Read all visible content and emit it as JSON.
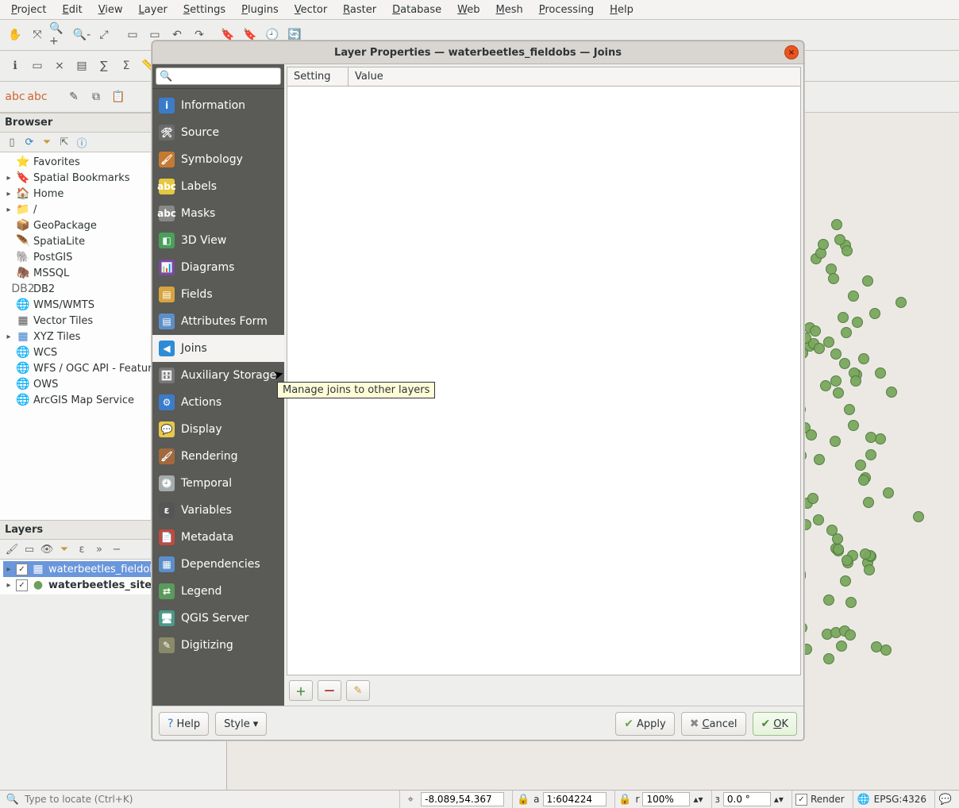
{
  "menubar": [
    "Project",
    "Edit",
    "View",
    "Layer",
    "Settings",
    "Plugins",
    "Vector",
    "Raster",
    "Database",
    "Web",
    "Mesh",
    "Processing",
    "Help"
  ],
  "browser": {
    "title": "Browser",
    "items": [
      {
        "exp": "",
        "icon": "⭐",
        "iconClass": "star",
        "label": "Favorites",
        "name": "favorites"
      },
      {
        "exp": "▸",
        "icon": "🔖",
        "iconClass": "",
        "label": "Spatial Bookmarks",
        "name": "spatial-bookmarks"
      },
      {
        "exp": "▸",
        "icon": "🏠",
        "iconClass": "",
        "label": "Home",
        "name": "home"
      },
      {
        "exp": "▸",
        "icon": "📁",
        "iconClass": "folder",
        "label": "/",
        "name": "root-folder"
      },
      {
        "exp": "",
        "icon": "📦",
        "iconClass": "pkg",
        "label": "GeoPackage",
        "name": "geopackage"
      },
      {
        "exp": "",
        "icon": "🪶",
        "iconClass": "",
        "label": "SpatiaLite",
        "name": "spatialite"
      },
      {
        "exp": "",
        "icon": "🐘",
        "iconClass": "",
        "label": "PostGIS",
        "name": "postgis"
      },
      {
        "exp": "",
        "icon": "🦣",
        "iconClass": "",
        "label": "MSSQL",
        "name": "mssql"
      },
      {
        "exp": "",
        "icon": "DB2",
        "iconClass": "db",
        "label": "DB2",
        "name": "db2"
      },
      {
        "exp": "",
        "icon": "🌐",
        "iconClass": "globe",
        "label": "WMS/WMTS",
        "name": "wms"
      },
      {
        "exp": "",
        "icon": "▦",
        "iconClass": "grid",
        "label": "Vector Tiles",
        "name": "vector-tiles"
      },
      {
        "exp": "▸",
        "icon": "▦",
        "iconClass": "blue",
        "label": "XYZ Tiles",
        "name": "xyz-tiles"
      },
      {
        "exp": "",
        "icon": "🌐",
        "iconClass": "globe",
        "label": "WCS",
        "name": "wcs"
      },
      {
        "exp": "",
        "icon": "🌐",
        "iconClass": "globe",
        "label": "WFS / OGC API - Features",
        "name": "wfs"
      },
      {
        "exp": "",
        "icon": "🌐",
        "iconClass": "globe",
        "label": "OWS",
        "name": "ows"
      },
      {
        "exp": "",
        "icon": "🌐",
        "iconClass": "globe",
        "label": "ArcGIS Map Service",
        "name": "arcgis"
      }
    ]
  },
  "layersPanel": {
    "title": "Layers",
    "layers": [
      {
        "checked": true,
        "sel": true,
        "icon": "▦",
        "label": "waterbeetles_fieldobs",
        "name": "layer-waterbeetles-fieldobs"
      },
      {
        "checked": true,
        "sel": false,
        "icon": "●",
        "label": "waterbeetles_sites",
        "name": "layer-waterbeetles-sites"
      }
    ]
  },
  "dialog": {
    "title": "Layer Properties — waterbeetles_fieldobs — Joins",
    "searchPlaceholder": "",
    "nav": [
      {
        "label": "Information",
        "icon": "i",
        "bg": "#3b7cc9",
        "name": "nav-information"
      },
      {
        "label": "Source",
        "icon": "🛠",
        "bg": "#6b6b6b",
        "name": "nav-source"
      },
      {
        "label": "Symbology",
        "icon": "🖌",
        "bg": "#c47a33",
        "name": "nav-symbology"
      },
      {
        "label": "Labels",
        "icon": "abc",
        "bg": "#e6c83e",
        "name": "nav-labels"
      },
      {
        "label": "Masks",
        "icon": "abc",
        "bg": "#888",
        "name": "nav-masks"
      },
      {
        "label": "3D View",
        "icon": "◧",
        "bg": "#4aa05a",
        "name": "nav-3dview"
      },
      {
        "label": "Diagrams",
        "icon": "📊",
        "bg": "#7a4aa0",
        "name": "nav-diagrams"
      },
      {
        "label": "Fields",
        "icon": "▤",
        "bg": "#d6a53e",
        "name": "nav-fields"
      },
      {
        "label": "Attributes Form",
        "icon": "▤",
        "bg": "#5c8fc9",
        "name": "nav-attributes-form"
      },
      {
        "label": "Joins",
        "icon": "◀",
        "bg": "#2e8cd6",
        "name": "nav-joins",
        "active": true
      },
      {
        "label": "Auxiliary Storage",
        "icon": "🗄",
        "bg": "#777",
        "name": "nav-aux-storage"
      },
      {
        "label": "Actions",
        "icon": "⚙",
        "bg": "#3b7cc9",
        "name": "nav-actions"
      },
      {
        "label": "Display",
        "icon": "💬",
        "bg": "#e7c94b",
        "name": "nav-display"
      },
      {
        "label": "Rendering",
        "icon": "🖌",
        "bg": "#a06a3e",
        "name": "nav-rendering"
      },
      {
        "label": "Temporal",
        "icon": "🕘",
        "bg": "#aaa",
        "name": "nav-temporal"
      },
      {
        "label": "Variables",
        "icon": "ε",
        "bg": "#555",
        "name": "nav-variables"
      },
      {
        "label": "Metadata",
        "icon": "📄",
        "bg": "#c04a3e",
        "name": "nav-metadata"
      },
      {
        "label": "Dependencies",
        "icon": "▦",
        "bg": "#5c8fc9",
        "name": "nav-dependencies"
      },
      {
        "label": "Legend",
        "icon": "⇄",
        "bg": "#5a9a5a",
        "name": "nav-legend"
      },
      {
        "label": "QGIS Server",
        "icon": "🖥",
        "bg": "#4a9a8a",
        "name": "nav-qgis-server"
      },
      {
        "label": "Digitizing",
        "icon": "✎",
        "bg": "#8a8a6a",
        "name": "nav-digitizing"
      }
    ],
    "columns": {
      "setting": "Setting",
      "value": "Value"
    },
    "tooltip": "Manage joins to other layers",
    "buttons": {
      "add": "＋",
      "remove": "—",
      "edit": "✎",
      "help": "Help",
      "style": "Style",
      "apply": "Apply",
      "cancel": "Cancel",
      "ok": "OK"
    }
  },
  "statusbar": {
    "locatePlaceholder": "Type to locate (Ctrl+K)",
    "coord": "-8.089,54.367",
    "scalePrefix": "1:",
    "scale": "604224",
    "magnifier": "100%",
    "rotation": "0.0 °",
    "renderLabel": "Render",
    "crs": "EPSG:4326"
  }
}
